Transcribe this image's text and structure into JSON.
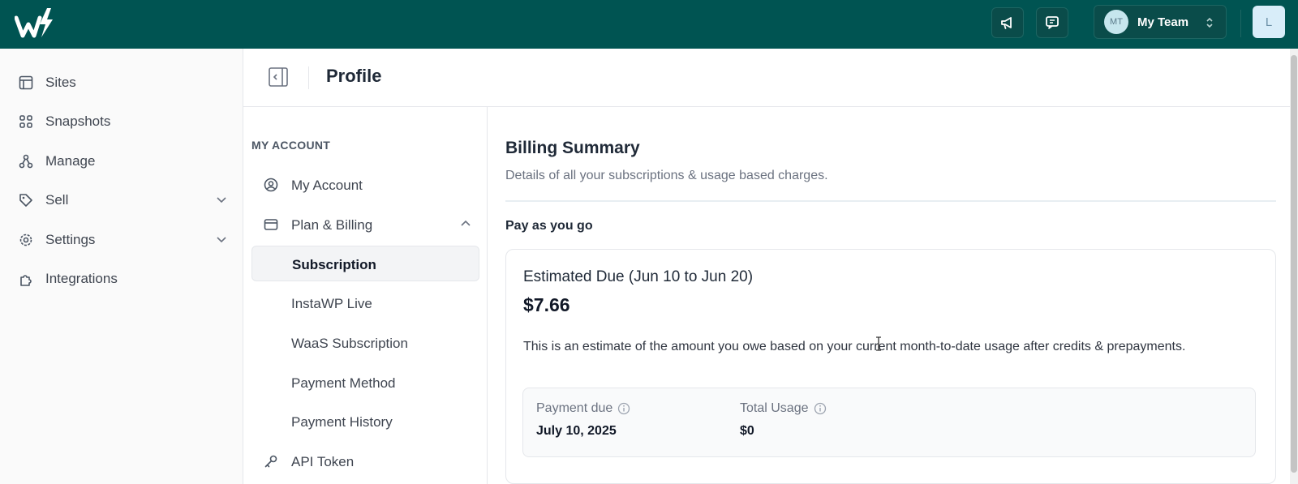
{
  "topbar": {
    "team": {
      "initials": "MT",
      "name": "My Team"
    },
    "user_initial": "L"
  },
  "sidebar": {
    "items": [
      {
        "label": "Sites",
        "icon": "layout-icon"
      },
      {
        "label": "Snapshots",
        "icon": "grid-icon"
      },
      {
        "label": "Manage",
        "icon": "nodes-icon"
      },
      {
        "label": "Sell",
        "icon": "tag-icon",
        "expandable": true
      },
      {
        "label": "Settings",
        "icon": "gear-icon",
        "expandable": true
      },
      {
        "label": "Integrations",
        "icon": "puzzle-icon"
      }
    ]
  },
  "header": {
    "title": "Profile"
  },
  "subnav": {
    "heading": "MY ACCOUNT",
    "items": [
      {
        "label": "My Account",
        "icon": "user-circle-icon"
      },
      {
        "label": "Plan & Billing",
        "icon": "card-icon",
        "expanded": true
      },
      {
        "label": "Subscription",
        "active": true
      },
      {
        "label": "InstaWP Live"
      },
      {
        "label": "WaaS Subscription"
      },
      {
        "label": "Payment Method"
      },
      {
        "label": "Payment History"
      },
      {
        "label": "API Token",
        "icon": "key-icon"
      }
    ]
  },
  "billing": {
    "title": "Billing Summary",
    "subtitle": "Details of all your subscriptions & usage based charges.",
    "section": "Pay as you go",
    "estimate_title": "Estimated Due (Jun 10 to Jun 20)",
    "estimate_amount": "$7.66",
    "estimate_desc": "This is an estimate of the amount you owe based on your current month-to-date usage after credits & prepayments.",
    "payment_due_label": "Payment due",
    "payment_due_value": "July 10, 2025",
    "total_usage_label": "Total Usage",
    "total_usage_value": "$0"
  },
  "colors": {
    "brand": "#005452",
    "active_bg": "#f3f4f6"
  }
}
